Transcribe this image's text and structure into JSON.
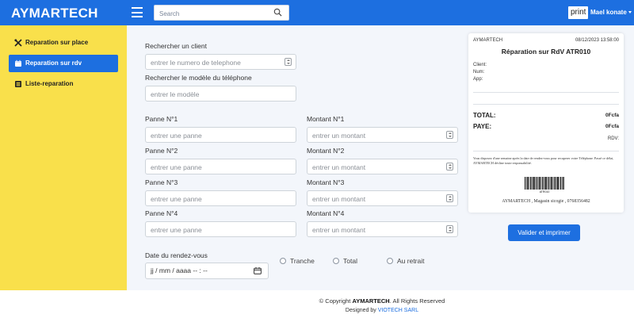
{
  "header": {
    "brand": "AYMARTECH",
    "search_placeholder": "Search",
    "print_label": "print",
    "user_name": "Mael konate"
  },
  "sidebar": {
    "items": [
      {
        "label": "Reparation sur place",
        "icon": "tools-icon",
        "active": false
      },
      {
        "label": "Reparation sur rdv",
        "icon": "calendar-icon",
        "active": true
      },
      {
        "label": "Liste-reparation",
        "icon": "list-icon",
        "active": false
      }
    ]
  },
  "form": {
    "client_label": "Rechercher un client",
    "client_placeholder": "entrer le numero de telephone",
    "model_label": "Rechercher le modèle du téléphone",
    "model_placeholder": "entrer le modèle",
    "pannes": [
      {
        "panne_label": "Panne N°1",
        "panne_placeholder": "entrer une panne",
        "montant_label": "Montant N°1",
        "montant_placeholder": "entrer un montant"
      },
      {
        "panne_label": "Panne N°2",
        "panne_placeholder": "entrer une panne",
        "montant_label": "Montant N°2",
        "montant_placeholder": "entrer un montant"
      },
      {
        "panne_label": "Panne N°3",
        "panne_placeholder": "entrer une panne",
        "montant_label": "Montant N°3",
        "montant_placeholder": "entrer un montant"
      },
      {
        "panne_label": "Panne N°4",
        "panne_placeholder": "entrer une panne",
        "montant_label": "Montant N°4",
        "montant_placeholder": "entrer un montant"
      }
    ],
    "date_label": "Date du rendez-vous",
    "date_value": "jj / mm / aaaa  -- : --",
    "payment_options": [
      "Tranche",
      "Total",
      "Au retrait"
    ],
    "submit_label": "Valider et imprimer"
  },
  "receipt": {
    "company": "AYMARTECH",
    "datetime": "08/12/2023 13:58:00",
    "title": "Réparation sur RdV ATR010",
    "client_label": "Client:",
    "num_label": "Num:",
    "app_label": "App:",
    "total_label": "TOTAL:",
    "total_value": "0Fcfa",
    "paye_label": "PAYE:",
    "paye_value": "0Fcfa",
    "rdv_label": "RDV:",
    "note": "Vous disposez d'une semaine après la date de rendez-vous pour recuperer votre Téléphone. Passé ce délai, AYMARTECH décline toute responsabilité.",
    "barcode_number": "ATR010",
    "footer": "AYMARTECH , Magasin sicogie , 0768356482"
  },
  "footer": {
    "copyright_prefix": "© Copyright ",
    "copyright_brand": "AYMARTECH",
    "copyright_suffix": ". All Rights Reserved",
    "designed_prefix": "Designed by ",
    "designed_by": "VIOTECH SARL"
  }
}
